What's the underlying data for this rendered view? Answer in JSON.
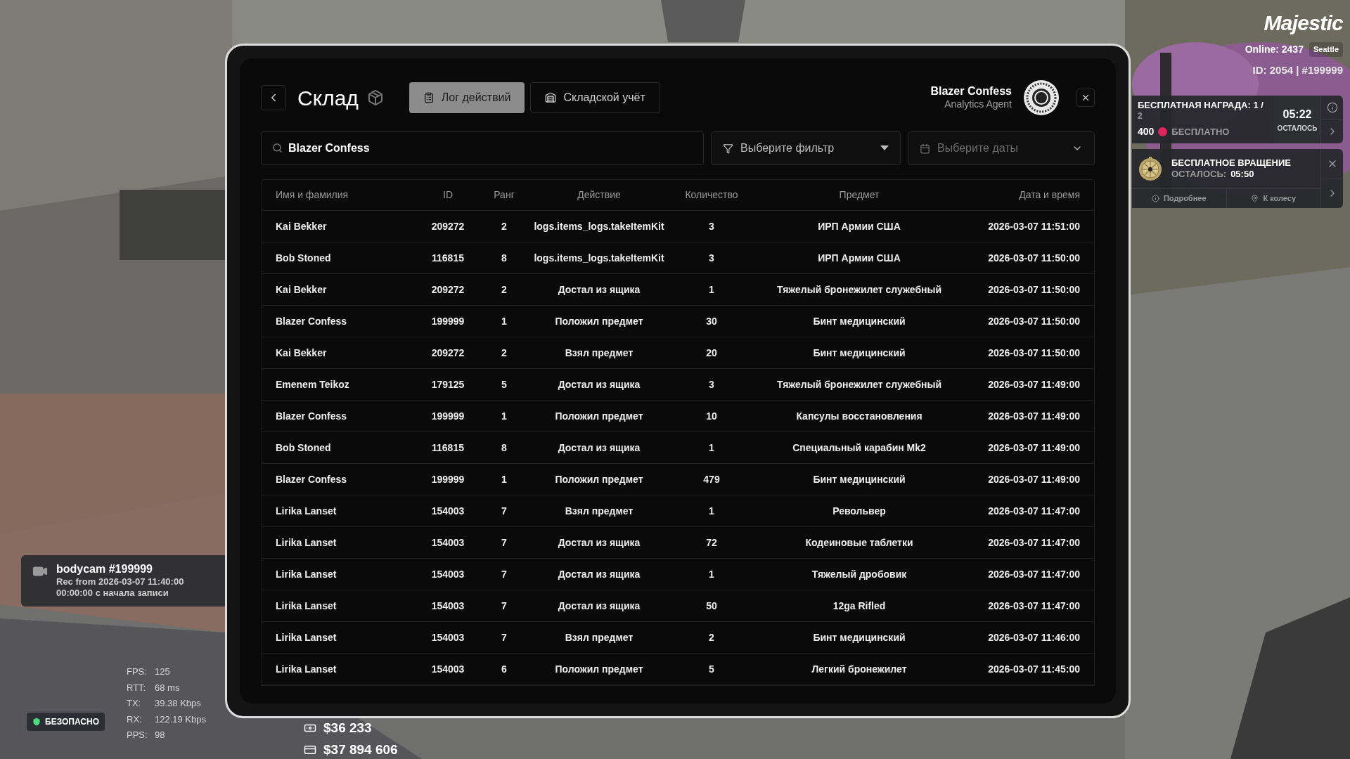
{
  "warehouse": {
    "title": "Склад",
    "tabs": [
      {
        "label": "Лог действий",
        "selected": true,
        "kind": "log"
      },
      {
        "label": "Складской учёт",
        "selected": false,
        "kind": "stock"
      }
    ],
    "user": {
      "name": "Blazer Confess",
      "role": "Analytics Agent"
    },
    "search": {
      "value": "Blazer Confess"
    },
    "filter": {
      "placeholder": "Выберите фильтр"
    },
    "dates": {
      "placeholder": "Выберите даты"
    },
    "table": {
      "columns": [
        "Имя и фамилия",
        "ID",
        "Ранг",
        "Действие",
        "Количество",
        "Предмет",
        "Дата и время"
      ],
      "rows": [
        [
          "Kai Bekker",
          "209272",
          "2",
          "logs.items_logs.takeItemKit",
          "3",
          "ИРП Армии США",
          "2026-03-07 11:51:00"
        ],
        [
          "Bob Stoned",
          "116815",
          "8",
          "logs.items_logs.takeItemKit",
          "3",
          "ИРП Армии США",
          "2026-03-07 11:50:00"
        ],
        [
          "Kai Bekker",
          "209272",
          "2",
          "Достал из ящика",
          "1",
          "Тяжелый бронежилет служебный",
          "2026-03-07 11:50:00"
        ],
        [
          "Blazer Confess",
          "199999",
          "1",
          "Положил предмет",
          "30",
          "Бинт медицинский",
          "2026-03-07 11:50:00"
        ],
        [
          "Kai Bekker",
          "209272",
          "2",
          "Взял предмет",
          "20",
          "Бинт медицинский",
          "2026-03-07 11:50:00"
        ],
        [
          "Emenem Teikoz",
          "179125",
          "5",
          "Достал из ящика",
          "3",
          "Тяжелый бронежилет служебный",
          "2026-03-07 11:49:00"
        ],
        [
          "Blazer Confess",
          "199999",
          "1",
          "Положил предмет",
          "10",
          "Капсулы восстановления",
          "2026-03-07 11:49:00"
        ],
        [
          "Bob Stoned",
          "116815",
          "8",
          "Достал из ящика",
          "1",
          "Специальный карабин Mk2",
          "2026-03-07 11:49:00"
        ],
        [
          "Blazer Confess",
          "199999",
          "1",
          "Положил предмет",
          "479",
          "Бинт медицинский",
          "2026-03-07 11:49:00"
        ],
        [
          "Lirika Lanset",
          "154003",
          "7",
          "Взял предмет",
          "1",
          "Револьвер",
          "2026-03-07 11:47:00"
        ],
        [
          "Lirika Lanset",
          "154003",
          "7",
          "Достал из ящика",
          "72",
          "Кодеиновые таблетки",
          "2026-03-07 11:47:00"
        ],
        [
          "Lirika Lanset",
          "154003",
          "7",
          "Достал из ящика",
          "1",
          "Тяжелый дробовик",
          "2026-03-07 11:47:00"
        ],
        [
          "Lirika Lanset",
          "154003",
          "7",
          "Достал из ящика",
          "50",
          "12ga Rifled",
          "2026-03-07 11:47:00"
        ],
        [
          "Lirika Lanset",
          "154003",
          "7",
          "Взял предмет",
          "2",
          "Бинт медицинский",
          "2026-03-07 11:46:00"
        ],
        [
          "Lirika Lanset",
          "154003",
          "6",
          "Положил предмет",
          "5",
          "Легкий бронежилет",
          "2026-03-07 11:45:00"
        ]
      ]
    }
  },
  "hud": {
    "logo": "Majestic",
    "online": "Online: 2437",
    "server": "Seattle",
    "player_id": "ID: 2054 | #199999",
    "reward": {
      "title": "БЕСПЛАТНАЯ НАГРАДА: 1 /",
      "total": "2",
      "amount": "400",
      "price": "БЕСПЛАТНО",
      "timer": "05:22",
      "timer_label": "ОСТАЛОСЬ"
    },
    "spin": {
      "title": "БЕСПЛАТНОЕ ВРАЩЕНИЕ",
      "left_label": "ОСТАЛОСЬ:",
      "left_value": "05:50",
      "buttons": [
        "Подробнее",
        "К колесу"
      ]
    },
    "bodycam": {
      "title": "bodycam #199999",
      "lines": [
        "Rec from 2026-03-07 11:40:00",
        "00:00:00 с начала записи"
      ]
    },
    "stats": [
      {
        "label": "FPS:",
        "value": "125"
      },
      {
        "label": "RTT:",
        "value": "68 ms"
      },
      {
        "label": "TX:",
        "value": "39.38 Kbps"
      },
      {
        "label": "RX:",
        "value": "122.19 Kbps"
      },
      {
        "label": "PPS:",
        "value": "98"
      }
    ],
    "zone": "БЕЗОПАСНО",
    "money": [
      {
        "kind": "cash",
        "amount": "$36 233"
      },
      {
        "kind": "card",
        "amount": "$37 894 606"
      }
    ]
  }
}
